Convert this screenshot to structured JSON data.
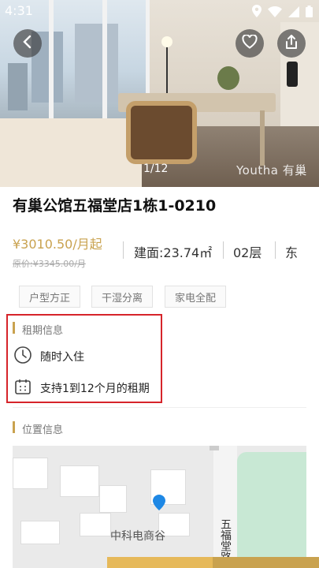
{
  "status_bar": {
    "time": "4:31"
  },
  "hero": {
    "image_counter": "1/12",
    "watermark": "Youtha 有巢"
  },
  "listing": {
    "title": "有巢公馆五福堂店1栋1-0210",
    "price": "¥3010.50/月起",
    "original_price": "原价:¥3345.00/月",
    "area": "建面:23.74㎡",
    "floor": "02层",
    "orientation": "东"
  },
  "tags": [
    "户型方正",
    "干湿分离",
    "家电全配"
  ],
  "rent_info": {
    "title": "租期信息",
    "items": [
      "随时入住",
      "支持1到12个月的租期"
    ]
  },
  "location": {
    "title": "位置信息",
    "map_label": "中科电商谷",
    "road_label": "五福堂路"
  },
  "colors": {
    "accent": "#c9a24f",
    "highlight": "#d6242a",
    "map_pin": "#1e88e5"
  }
}
